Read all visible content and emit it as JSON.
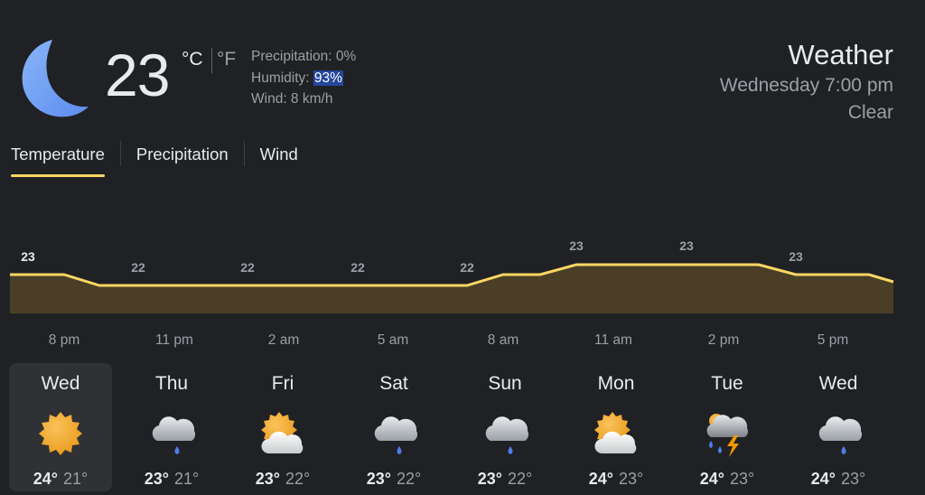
{
  "current": {
    "icon": "moon-icon",
    "temperature": "23",
    "unit_c": "°C",
    "unit_f": "°F",
    "precipitation": "Precipitation: 0%",
    "humidity_label": "Humidity: ",
    "humidity_value": "93%",
    "wind": "Wind: 8 km/h"
  },
  "header": {
    "title": "Weather",
    "datetime": "Wednesday 7:00 pm",
    "condition": "Clear"
  },
  "tabs": [
    {
      "label": "Temperature",
      "active": true
    },
    {
      "label": "Precipitation",
      "active": false
    },
    {
      "label": "Wind",
      "active": false
    }
  ],
  "colors": {
    "accent": "#fdd663",
    "chart_fill": "#4a3f26",
    "chart_line": "#fdd663"
  },
  "chart_data": {
    "type": "area",
    "x": [
      "8 pm",
      "11 pm",
      "2 am",
      "5 am",
      "8 am",
      "11 am",
      "2 pm",
      "5 pm"
    ],
    "values": [
      23,
      22,
      22,
      22,
      22,
      23,
      23,
      23
    ]
  },
  "days": [
    {
      "name": "Wed",
      "icon": "sun-icon",
      "high": "24°",
      "low": "21°",
      "selected": true
    },
    {
      "name": "Thu",
      "icon": "rain-cloud-icon",
      "high": "23°",
      "low": "21°",
      "selected": false
    },
    {
      "name": "Fri",
      "icon": "partly-cloudy-icon",
      "high": "23°",
      "low": "22°",
      "selected": false
    },
    {
      "name": "Sat",
      "icon": "rain-cloud-icon",
      "high": "23°",
      "low": "22°",
      "selected": false
    },
    {
      "name": "Sun",
      "icon": "rain-cloud-icon",
      "high": "23°",
      "low": "22°",
      "selected": false
    },
    {
      "name": "Mon",
      "icon": "partly-cloudy-icon",
      "high": "24°",
      "low": "23°",
      "selected": false
    },
    {
      "name": "Tue",
      "icon": "thunderstorm-icon",
      "high": "24°",
      "low": "23°",
      "selected": false
    },
    {
      "name": "Wed",
      "icon": "rain-cloud-icon",
      "high": "24°",
      "low": "23°",
      "selected": false
    }
  ]
}
